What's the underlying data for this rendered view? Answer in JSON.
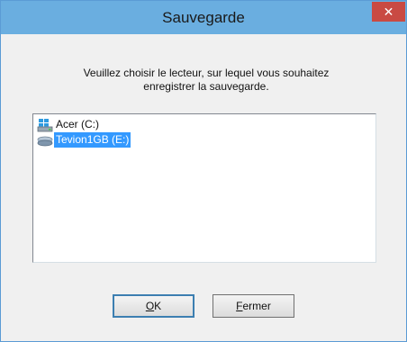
{
  "window": {
    "title": "Sauvegarde",
    "close_glyph": "✕",
    "close_icon": "close-icon"
  },
  "message": {
    "line1": "Veuillez choisir le lecteur, sur lequel vous souhaitez",
    "line2": "enregistrer la sauvegarde."
  },
  "drives": [
    {
      "label": "Acer (C:)",
      "icon": "windows-drive-icon",
      "selected": false
    },
    {
      "label": "Tevion1GB (E:)",
      "icon": "usb-drive-icon",
      "selected": true
    }
  ],
  "buttons": {
    "ok": {
      "accel": "O",
      "rest": "K"
    },
    "close": {
      "accel": "F",
      "rest": "ermer"
    }
  },
  "colors": {
    "titlebar": "#6aaee0",
    "close_button": "#c94a43",
    "selection": "#3399ff"
  }
}
